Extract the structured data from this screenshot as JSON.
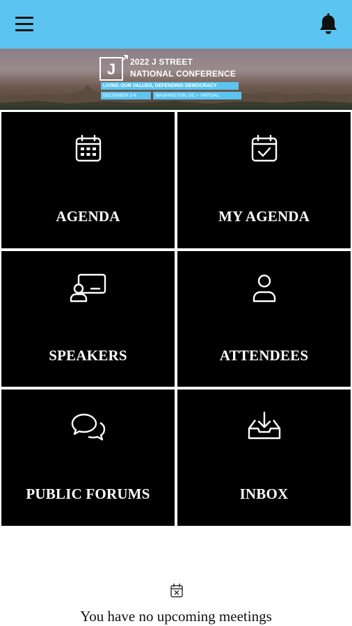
{
  "header": {
    "menu_icon": "hamburger-icon",
    "notifications_icon": "bell-icon",
    "background": "#5bc4f1"
  },
  "banner": {
    "logo_letter": "J",
    "title_line1": "2022 J STREET",
    "title_line2": "NATIONAL CONFERENCE",
    "tagline": "LIVING OUR VALUES, DEFENDING DEMOCRACY",
    "dates": "DECEMBER 3-6",
    "location": "WASHINGTON, DC + VIRTUAL"
  },
  "tiles": [
    {
      "label": "AGENDA",
      "icon": "calendar-grid-icon"
    },
    {
      "label": "MY AGENDA",
      "icon": "calendar-check-icon"
    },
    {
      "label": "SPEAKERS",
      "icon": "presenter-icon"
    },
    {
      "label": "ATTENDEES",
      "icon": "person-icon"
    },
    {
      "label": "PUBLIC FORUMS",
      "icon": "chat-bubbles-icon"
    },
    {
      "label": "INBOX",
      "icon": "inbox-download-icon"
    }
  ],
  "meetings": {
    "icon": "calendar-x-icon",
    "empty_text": "You have no upcoming meetings"
  }
}
